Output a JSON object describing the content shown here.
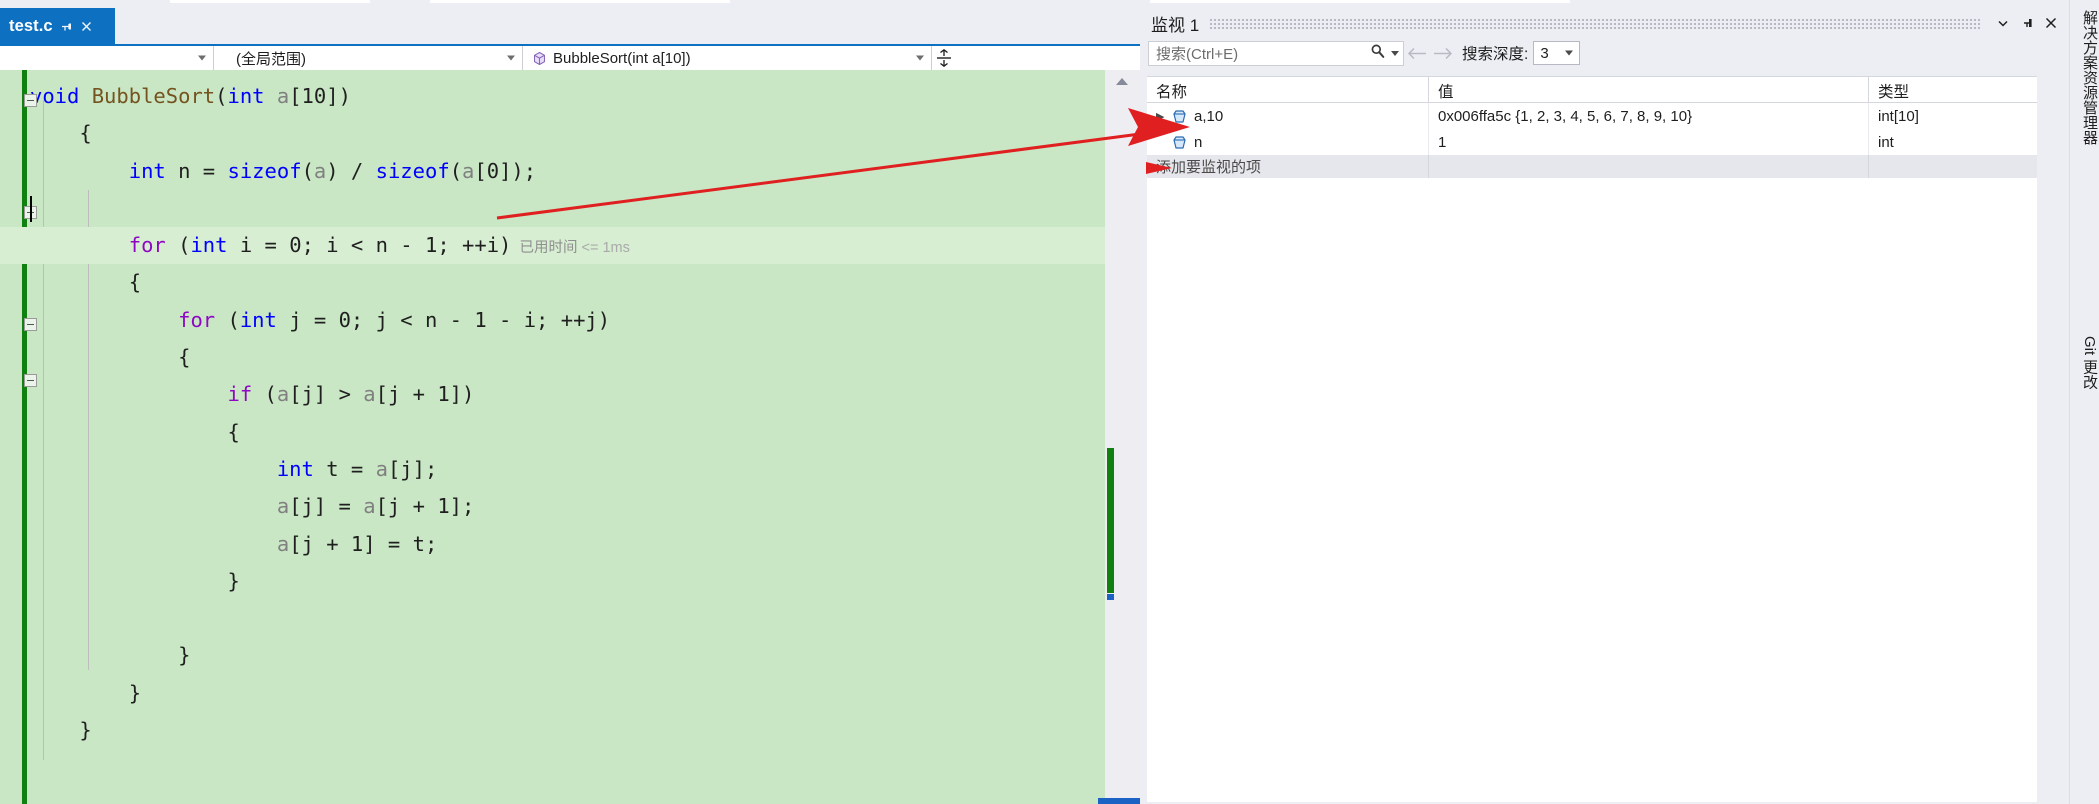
{
  "editor": {
    "tab": {
      "label": "test.c",
      "pin_icon": "pin-icon",
      "close_icon": "close-icon"
    },
    "navbar": {
      "scope_value": "",
      "global_scope": "(全局范围)",
      "function": "BubbleSort(int a[10])",
      "function_icon": "cube-icon",
      "splitter_icon": "split-window-icon"
    },
    "code": [
      {
        "indent": 0,
        "tokens": [
          {
            "t": "void",
            "c": "k"
          },
          {
            "t": " ",
            "c": "pl"
          },
          {
            "t": "BubbleSort",
            "c": "fn"
          },
          {
            "t": "(",
            "c": "pl"
          },
          {
            "t": "int",
            "c": "k"
          },
          {
            "t": " ",
            "c": "pl"
          },
          {
            "t": "a",
            "c": "var"
          },
          {
            "t": "[",
            "c": "pl"
          },
          {
            "t": "10",
            "c": "num"
          },
          {
            "t": "])",
            "c": "pl"
          }
        ]
      },
      {
        "indent": 1,
        "tokens": [
          {
            "t": "{",
            "c": "pl"
          }
        ]
      },
      {
        "indent": 2,
        "tokens": [
          {
            "t": "int",
            "c": "k"
          },
          {
            "t": " n = ",
            "c": "pl"
          },
          {
            "t": "sizeof",
            "c": "k"
          },
          {
            "t": "(",
            "c": "pl"
          },
          {
            "t": "a",
            "c": "var"
          },
          {
            "t": ") / ",
            "c": "pl"
          },
          {
            "t": "sizeof",
            "c": "k"
          },
          {
            "t": "(",
            "c": "pl"
          },
          {
            "t": "a",
            "c": "var"
          },
          {
            "t": "[",
            "c": "pl"
          },
          {
            "t": "0",
            "c": "num"
          },
          {
            "t": "]);",
            "c": "pl"
          }
        ]
      },
      {
        "indent": 2,
        "tokens": []
      },
      {
        "indent": 2,
        "tokens": [
          {
            "t": "for",
            "c": "kw2"
          },
          {
            "t": " (",
            "c": "pl"
          },
          {
            "t": "int",
            "c": "k"
          },
          {
            "t": " i = ",
            "c": "pl"
          },
          {
            "t": "0",
            "c": "num"
          },
          {
            "t": "; i < n - ",
            "c": "pl"
          },
          {
            "t": "1",
            "c": "num"
          },
          {
            "t": "; ++i)",
            "c": "pl"
          }
        ]
      },
      {
        "indent": 2,
        "tokens": [
          {
            "t": "{",
            "c": "pl"
          }
        ]
      },
      {
        "indent": 3,
        "tokens": [
          {
            "t": "for",
            "c": "kw2"
          },
          {
            "t": " (",
            "c": "pl"
          },
          {
            "t": "int",
            "c": "k"
          },
          {
            "t": " j = ",
            "c": "pl"
          },
          {
            "t": "0",
            "c": "num"
          },
          {
            "t": "; j < n - ",
            "c": "pl"
          },
          {
            "t": "1",
            "c": "num"
          },
          {
            "t": " - i; ++j)",
            "c": "pl"
          }
        ]
      },
      {
        "indent": 3,
        "tokens": [
          {
            "t": "{",
            "c": "pl"
          }
        ]
      },
      {
        "indent": 4,
        "tokens": [
          {
            "t": "if",
            "c": "kw2"
          },
          {
            "t": " (",
            "c": "pl"
          },
          {
            "t": "a",
            "c": "var"
          },
          {
            "t": "[j] > ",
            "c": "pl"
          },
          {
            "t": "a",
            "c": "var"
          },
          {
            "t": "[j + ",
            "c": "pl"
          },
          {
            "t": "1",
            "c": "num"
          },
          {
            "t": "])",
            "c": "pl"
          }
        ]
      },
      {
        "indent": 4,
        "tokens": [
          {
            "t": "{",
            "c": "pl"
          }
        ]
      },
      {
        "indent": 5,
        "tokens": [
          {
            "t": "int",
            "c": "k"
          },
          {
            "t": " t = ",
            "c": "pl"
          },
          {
            "t": "a",
            "c": "var"
          },
          {
            "t": "[j];",
            "c": "pl"
          }
        ]
      },
      {
        "indent": 5,
        "tokens": [
          {
            "t": "a",
            "c": "var"
          },
          {
            "t": "[j] = ",
            "c": "pl"
          },
          {
            "t": "a",
            "c": "var"
          },
          {
            "t": "[j + ",
            "c": "pl"
          },
          {
            "t": "1",
            "c": "num"
          },
          {
            "t": "];",
            "c": "pl"
          }
        ]
      },
      {
        "indent": 5,
        "tokens": [
          {
            "t": "a",
            "c": "var"
          },
          {
            "t": "[j + ",
            "c": "pl"
          },
          {
            "t": "1",
            "c": "num"
          },
          {
            "t": "] = t;",
            "c": "pl"
          }
        ]
      },
      {
        "indent": 4,
        "tokens": [
          {
            "t": "}",
            "c": "pl"
          }
        ]
      },
      {
        "indent": 4,
        "tokens": []
      },
      {
        "indent": 3,
        "tokens": [
          {
            "t": "}",
            "c": "pl"
          }
        ]
      },
      {
        "indent": 2,
        "tokens": [
          {
            "t": "}",
            "c": "pl"
          }
        ]
      },
      {
        "indent": 1,
        "tokens": [
          {
            "t": "}",
            "c": "pl"
          }
        ]
      }
    ],
    "elapsed_annotation": {
      "label": "已用时间",
      "value": "<= 1ms"
    }
  },
  "watch": {
    "title": "监视 1",
    "dropdown_icon": "chevron-down-icon",
    "pin_icon": "pin-icon",
    "close_icon": "close-icon",
    "search": {
      "placeholder": "搜索(Ctrl+E)",
      "value": "",
      "icon": "search-icon",
      "options_icon": "chevron-down-icon"
    },
    "prev_icon": "arrow-left-icon",
    "next_icon": "arrow-right-icon",
    "depth_label": "搜索深度:",
    "depth_value": "3",
    "columns": [
      "名称",
      "值",
      "类型"
    ],
    "rows": [
      {
        "expandable": true,
        "expander": "▶",
        "icon": "watch-variable-icon",
        "name": "a,10",
        "value": "0x006ffa5c {1, 2, 3, 4, 5, 6, 7, 8, 9, 10}",
        "type": "int[10]",
        "changed": false
      },
      {
        "expandable": false,
        "expander": "",
        "icon": "watch-variable-icon",
        "name": "n",
        "value": "1",
        "type": "int",
        "changed": true
      }
    ],
    "add_row_placeholder": "添加要监视的项"
  },
  "right_rail": {
    "tabs": [
      {
        "label": "解决方案资源管理器"
      },
      {
        "label": "Git 更改"
      }
    ]
  },
  "colors": {
    "accent": "#0e70c0",
    "modified_green": "#c9e7c4",
    "change_bar": "#108010",
    "changed_value": "#cf2020",
    "annotation_arrow": "#e02020"
  }
}
